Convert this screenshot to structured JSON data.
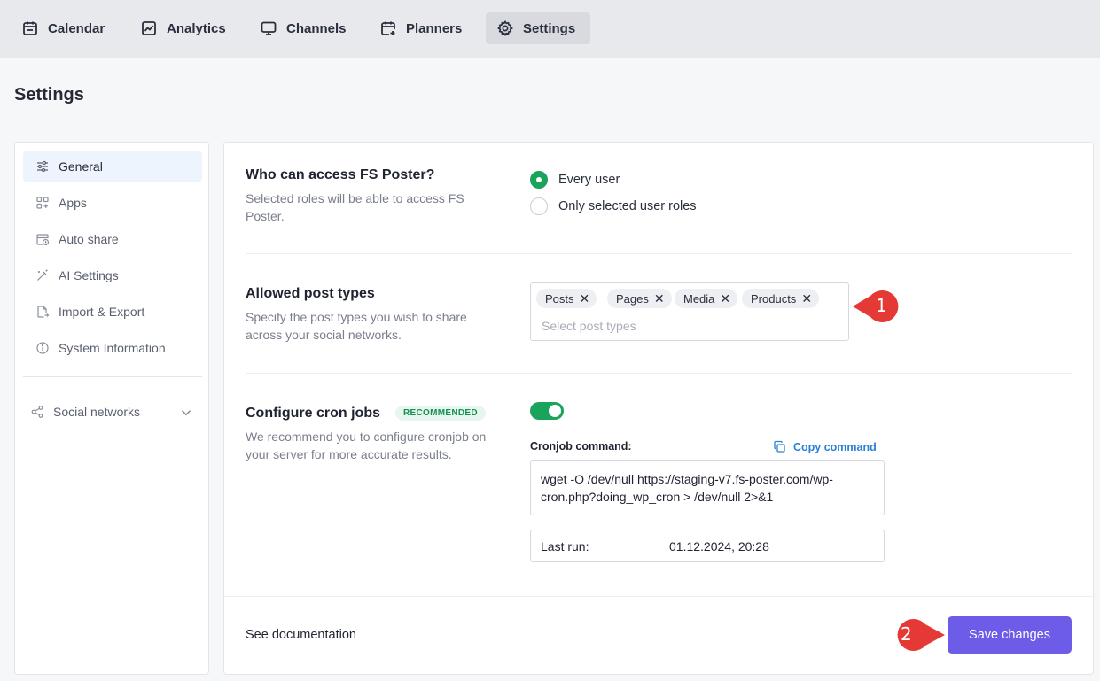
{
  "nav": {
    "tabs": [
      {
        "label": "Calendar",
        "icon": "calendar-icon"
      },
      {
        "label": "Analytics",
        "icon": "chart-icon"
      },
      {
        "label": "Channels",
        "icon": "monitor-icon"
      },
      {
        "label": "Planners",
        "icon": "calendar-plus-icon"
      },
      {
        "label": "Settings",
        "icon": "gear-icon",
        "active": true
      }
    ]
  },
  "page": {
    "title": "Settings"
  },
  "sidebar": {
    "items": [
      {
        "label": "General",
        "icon": "sliders-icon",
        "active": true
      },
      {
        "label": "Apps",
        "icon": "apps-grid-icon"
      },
      {
        "label": "Auto share",
        "icon": "calendar-clock-icon"
      },
      {
        "label": "AI Settings",
        "icon": "magic-wand-icon"
      },
      {
        "label": "Import & Export",
        "icon": "file-export-icon"
      },
      {
        "label": "System Information",
        "icon": "info-icon"
      }
    ],
    "social": {
      "label": "Social networks",
      "icon": "share-icon"
    }
  },
  "access": {
    "title": "Who can access FS Poster?",
    "description": "Selected roles will be able to access FS Poster.",
    "options": [
      {
        "label": "Every user",
        "checked": true
      },
      {
        "label": "Only selected user roles",
        "checked": false
      }
    ]
  },
  "post_types": {
    "title": "Allowed post types",
    "description": "Specify the post types you wish to share across your social networks.",
    "tags": [
      "Posts",
      "Pages",
      "Media",
      "Products"
    ],
    "remove_glyph": "✕",
    "placeholder": "Select post types"
  },
  "cron": {
    "title": "Configure cron jobs",
    "badge": "RECOMMENDED",
    "description": "We recommend you to configure cronjob on your server for more accurate results.",
    "enabled": true,
    "command_label": "Cronjob command:",
    "copy_label": "Copy command",
    "command": "wget -O /dev/null https://staging-v7.fs-poster.com/wp-cron.php?doing_wp_cron > /dev/null 2>&1",
    "last_run_label": "Last run:",
    "last_run_value": "01.12.2024, 20:28"
  },
  "footer": {
    "doc_link": "See documentation",
    "save_label": "Save changes"
  },
  "annotations": [
    {
      "number": "1"
    },
    {
      "number": "2"
    }
  ],
  "colors": {
    "accent": "#6c5ce7",
    "success": "#1aa35a",
    "link": "#2b7fd8",
    "marker": "#e53935"
  }
}
